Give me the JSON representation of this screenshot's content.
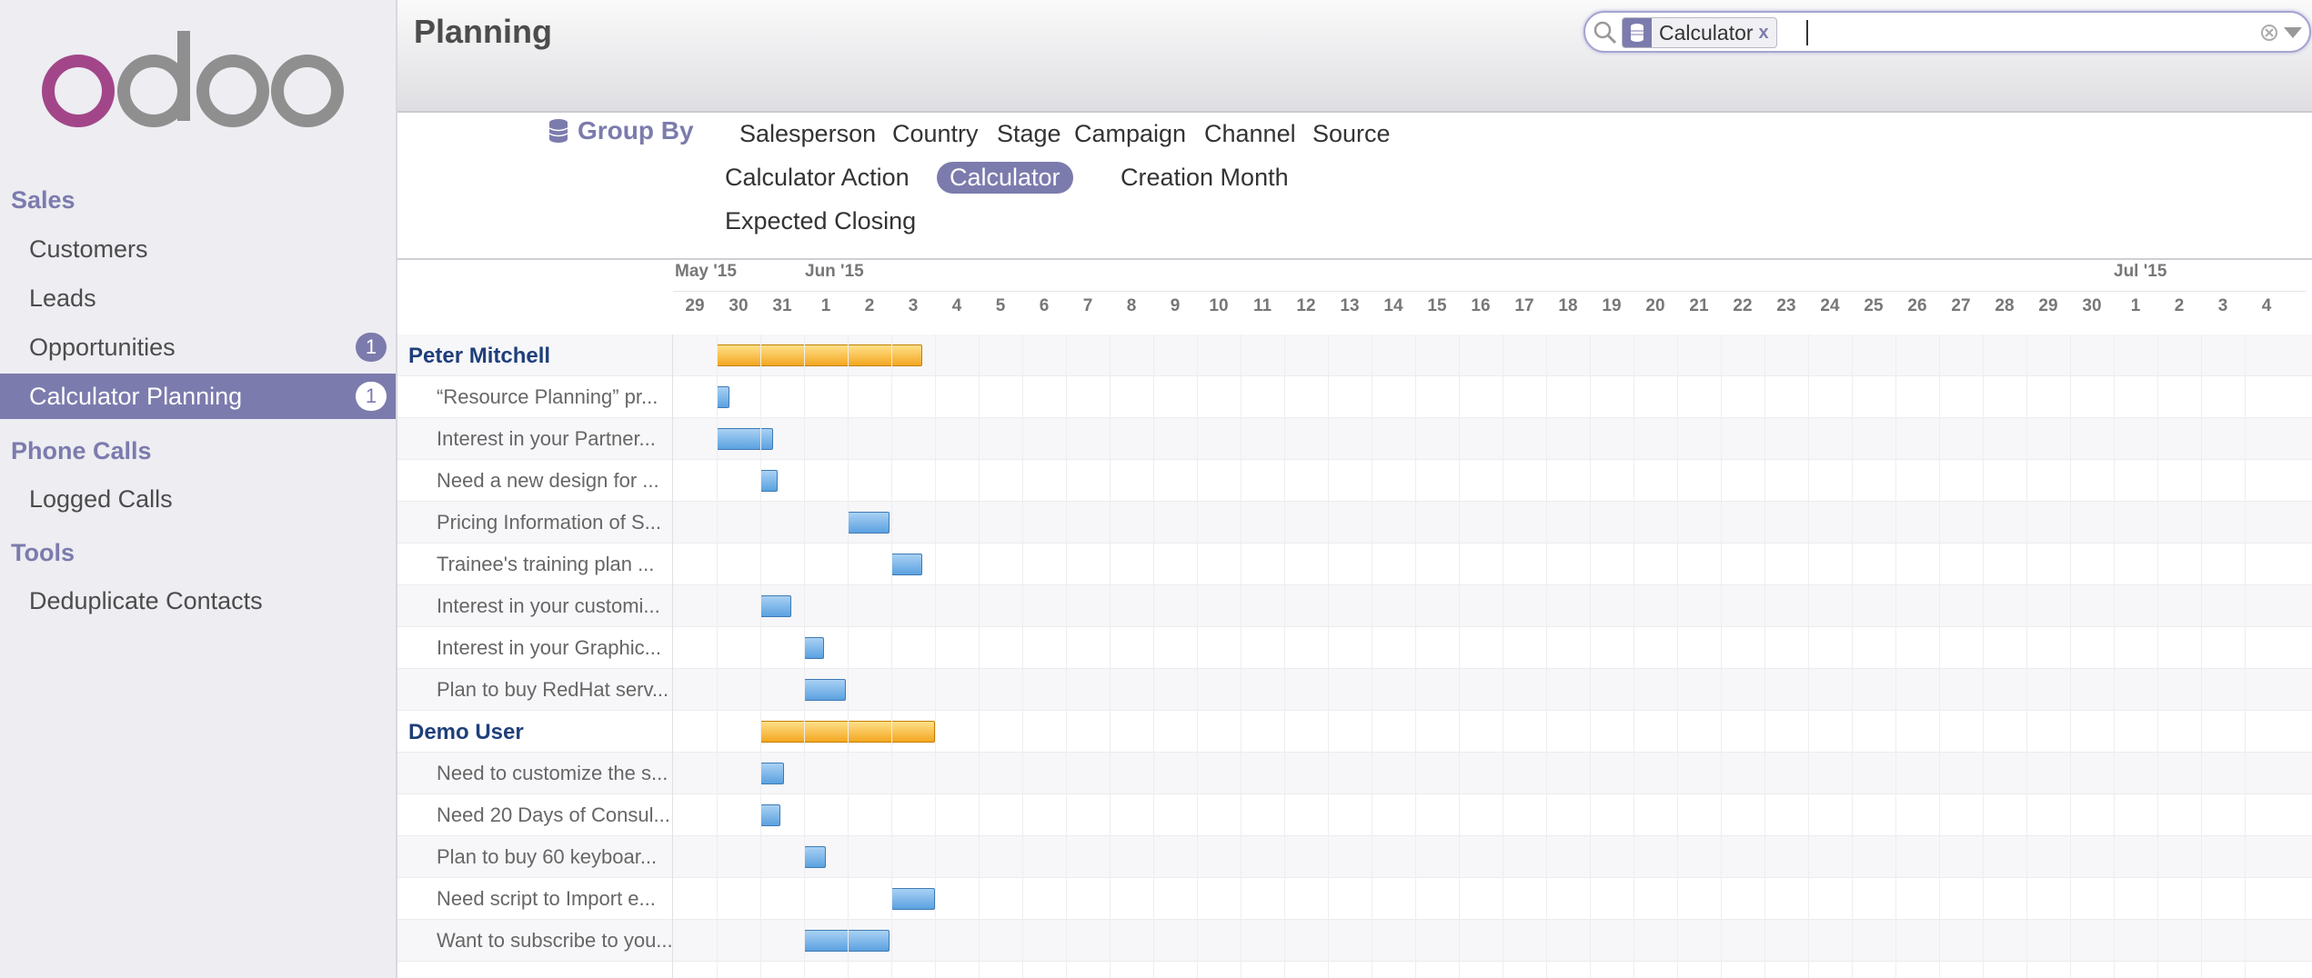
{
  "sidebar": {
    "logo_text": "odoo",
    "sections": [
      {
        "title": "Sales",
        "items": [
          {
            "label": "Customers",
            "badge": null
          },
          {
            "label": "Leads",
            "badge": null
          },
          {
            "label": "Opportunities",
            "badge": "1"
          },
          {
            "label": "Calculator Planning",
            "badge": "1"
          }
        ]
      },
      {
        "title": "Phone Calls",
        "items": [
          {
            "label": "Logged Calls",
            "badge": null
          }
        ]
      },
      {
        "title": "Tools",
        "items": [
          {
            "label": "Deduplicate Contacts",
            "badge": null
          }
        ]
      }
    ]
  },
  "header": {
    "title": "Planning",
    "search": {
      "facet_value": "Calculator",
      "facet_remove": "x"
    }
  },
  "group_by": {
    "label": "Group By",
    "options": [
      "Salesperson",
      "Country",
      "Stage",
      "Campaign",
      "Channel",
      "Source",
      "Calculator Action",
      "Calculator",
      "Creation Month",
      "Expected Closing"
    ],
    "active": "Calculator"
  },
  "gantt": {
    "months": [
      "May '15",
      "Jun '15",
      "Jul '15"
    ],
    "days": [
      "29",
      "30",
      "31",
      "1",
      "2",
      "3",
      "4",
      "5",
      "6",
      "7",
      "8",
      "9",
      "10",
      "11",
      "12",
      "13",
      "14",
      "15",
      "16",
      "17",
      "18",
      "19",
      "20",
      "21",
      "22",
      "23",
      "24",
      "25",
      "26",
      "27",
      "28",
      "29",
      "30",
      "1",
      "2",
      "3",
      "4"
    ],
    "rows": [
      {
        "label": "Peter Mitchell",
        "group": true
      },
      {
        "label": "“Resource Planning” pr...",
        "group": false
      },
      {
        "label": "Interest in your Partner...",
        "group": false
      },
      {
        "label": "Need a new design for ...",
        "group": false
      },
      {
        "label": "Pricing Information of S...",
        "group": false
      },
      {
        "label": "Trainee's training plan ...",
        "group": false
      },
      {
        "label": "Interest in your customi...",
        "group": false
      },
      {
        "label": "Interest in your Graphic...",
        "group": false
      },
      {
        "label": "Plan to buy RedHat serv...",
        "group": false
      },
      {
        "label": "Demo User",
        "group": true
      },
      {
        "label": "Need to customize the s...",
        "group": false
      },
      {
        "label": "Need 20 Days of Consul...",
        "group": false
      },
      {
        "label": "Plan to buy 60 keyboar...",
        "group": false
      },
      {
        "label": "Need script to Import e...",
        "group": false
      },
      {
        "label": "Want to subscribe to you...",
        "group": false
      }
    ]
  },
  "colors": {
    "accent": "#7c7bad",
    "group_bar": "#f3a721",
    "task_bar": "#5ba1e0",
    "group_label": "#1f3f7a"
  }
}
